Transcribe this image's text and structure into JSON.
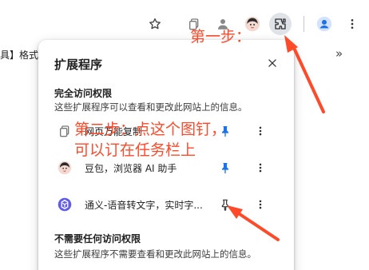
{
  "bookmarks": {
    "partial_text": "具】格式",
    "more_glyph": "»"
  },
  "panel": {
    "title": "扩展程序",
    "sections": [
      {
        "title": "完全访问权限",
        "description": "这些扩展程序可以查看和更改此网站上的信息。"
      },
      {
        "title": "不需要任何访问权限",
        "description": "这些扩展程序不需要查看和更改此网站上的信息。"
      }
    ],
    "extensions": [
      {
        "name": "网页万能复制",
        "icon": "copy-icon",
        "pinned": true
      },
      {
        "name": "豆包，浏览器 AI 助手",
        "icon": "doubao-avatar-icon",
        "pinned": true
      },
      {
        "name": "通义-语音转文字，实时字...",
        "icon": "tongyi-logo-icon",
        "pinned": false
      }
    ]
  },
  "annotations": {
    "step1": "第一步：",
    "step2_line1": "第二步：点这个图钉，",
    "step2_line2": "可以订在任务栏上",
    "color": "#ff4a2a"
  },
  "colors": {
    "pin_blue": "#1a73e8",
    "avatar_blue": "#1a73e8"
  }
}
